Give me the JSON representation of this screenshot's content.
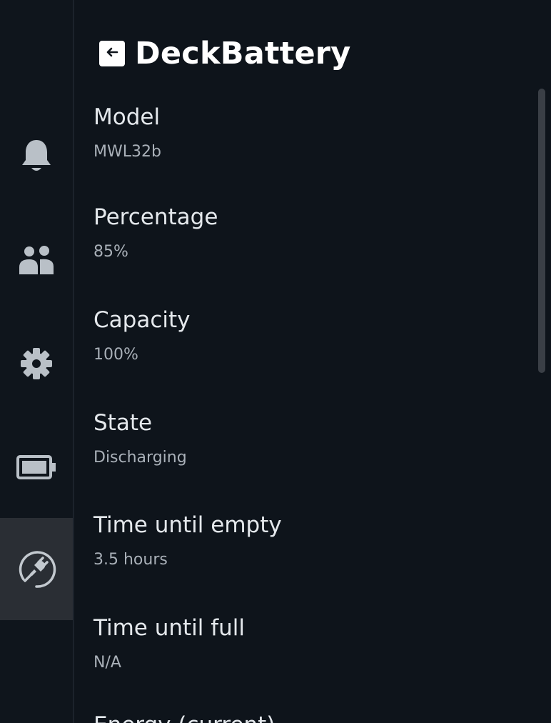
{
  "colors": {
    "background": "#0e141b",
    "sidebar_active": "#2a2e34",
    "label": "#e4e8ec",
    "value": "#a9b0b8"
  },
  "sidebar": {
    "items": [
      {
        "icon": "bell-icon"
      },
      {
        "icon": "friends-icon"
      },
      {
        "icon": "gear-icon"
      },
      {
        "icon": "battery-icon"
      },
      {
        "icon": "plugin-icon",
        "active": true
      }
    ]
  },
  "header": {
    "back_icon": "back-arrow-icon",
    "title": "DeckBattery"
  },
  "fields": [
    {
      "label": "Model",
      "value": "MWL32b"
    },
    {
      "label": "Percentage",
      "value": "85%"
    },
    {
      "label": "Capacity",
      "value": "100%"
    },
    {
      "label": "State",
      "value": "Discharging"
    },
    {
      "label": "Time until empty",
      "value": "3.5 hours"
    },
    {
      "label": "Time until full",
      "value": "N/A"
    },
    {
      "label": "Energy (current)"
    }
  ]
}
